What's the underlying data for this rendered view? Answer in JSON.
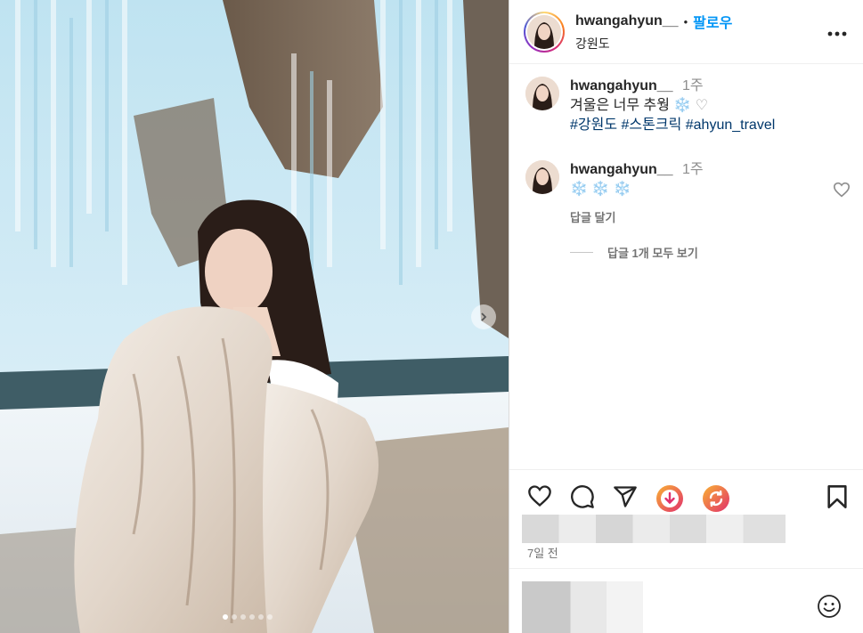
{
  "post": {
    "username": "hwangahyun__",
    "follow_label": "팔로우",
    "separator": "•",
    "location": "강원도",
    "more_label": "•••"
  },
  "caption": {
    "username": "hwangahyun__",
    "time": "1주",
    "text": "겨울은 너무 추웡",
    "snow_emoji": "❄️",
    "heart_emoji": "♡",
    "hashtags": [
      "#강원도",
      "#스톤크릭",
      "#ahyun_travel"
    ]
  },
  "comment": {
    "username": "hwangahyun__",
    "time": "1주",
    "text": "❄️ ❄️ ❄️",
    "reply_label": "답글 달기",
    "view_replies_label": "답글 1개 모두 보기"
  },
  "footer": {
    "date": "7일 전"
  },
  "carousel": {
    "slide_count": 6,
    "active_index": 0
  },
  "icons": [
    "heart-icon",
    "comment-icon",
    "share-icon",
    "download-icon",
    "refresh-icon",
    "bookmark-icon",
    "emoji-icon",
    "chevron-right-icon",
    "more-icon"
  ],
  "colors": {
    "accent": "#0095f6",
    "hashtag": "#00376b",
    "muted": "#737373"
  }
}
